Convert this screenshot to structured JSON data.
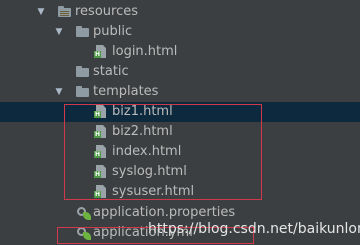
{
  "tree": {
    "resources": {
      "label": "resources",
      "icon": "resources-folder-icon"
    },
    "public": {
      "label": "public",
      "icon": "folder-icon"
    },
    "login": {
      "label": "login.html",
      "icon": "html-file-icon"
    },
    "static": {
      "label": "static",
      "icon": "folder-icon"
    },
    "templates": {
      "label": "templates",
      "icon": "folder-icon"
    },
    "templates_files": [
      {
        "label": "biz1.html",
        "icon": "html-file-icon"
      },
      {
        "label": "biz2.html",
        "icon": "html-file-icon"
      },
      {
        "label": "index.html",
        "icon": "html-file-icon"
      },
      {
        "label": "syslog.html",
        "icon": "html-file-icon"
      },
      {
        "label": "sysuser.html",
        "icon": "html-file-icon"
      }
    ],
    "app_properties": {
      "label": "application.properties",
      "icon": "spring-properties-icon"
    },
    "app_yml": {
      "label": "application.yml",
      "icon": "spring-yml-icon"
    }
  },
  "colors": {
    "background": "#3c3f41",
    "selected_row": "#0d293e",
    "highlight_border": "#d0394a",
    "text": "#bbbbbb"
  },
  "watermark": "https://blog.csdn.net/baikunlong"
}
